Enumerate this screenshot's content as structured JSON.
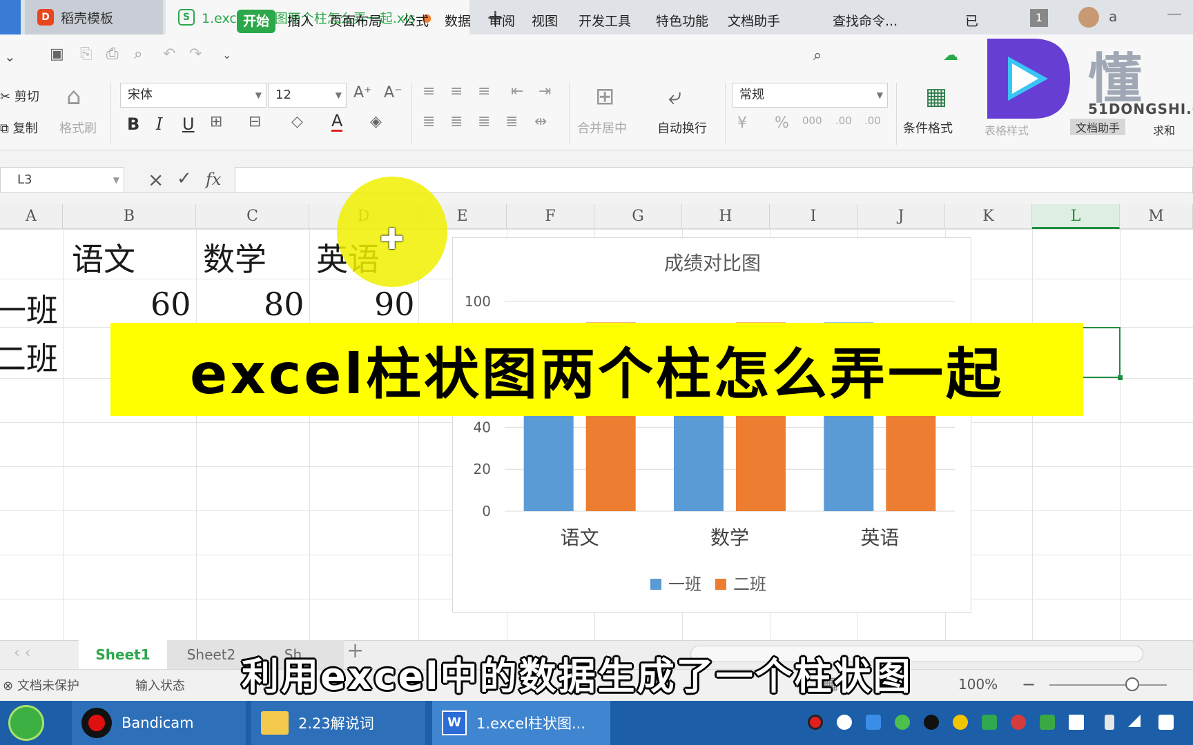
{
  "titlebar": {
    "tabs": [
      {
        "label": "稻壳模板",
        "active": false
      },
      {
        "label": "1.excel柱状图两个柱怎么弄一起.xls",
        "active": true
      }
    ],
    "new_tab_symbol": "+",
    "badge": "1",
    "user": "a",
    "minimize": "—"
  },
  "menu": {
    "items": [
      "开始",
      "插入",
      "页面布局",
      "公式",
      "数据",
      "审阅",
      "视图",
      "开发工具",
      "特色功能",
      "文档助手"
    ],
    "active": "开始",
    "search_placeholder": "查找命令...",
    "cloud_label": "已"
  },
  "ribbon": {
    "cut": "剪切",
    "copy": "复制",
    "format_painter": "格式刷",
    "font_name": "宋体",
    "font_size": "12",
    "merge_center": "合并居中",
    "wrap_text": "自动换行",
    "number_format": "常规",
    "conditional_format": "条件格式",
    "table_style": "表格样式",
    "doc_assistant": "文档助手",
    "sum": "求和"
  },
  "formula_bar": {
    "cell_ref": "L3",
    "fx": "fx",
    "content": ""
  },
  "columns": [
    "A",
    "B",
    "C",
    "D",
    "E",
    "F",
    "G",
    "H",
    "I",
    "J",
    "K",
    "L",
    "M"
  ],
  "cells": {
    "b1": "语文",
    "c1": "数学",
    "d1": "英语",
    "a2": "一班",
    "b2": "60",
    "c2": "80",
    "d2": "90",
    "a3": "二班"
  },
  "chart_data": {
    "type": "bar",
    "title": "成绩对比图",
    "categories": [
      "语文",
      "数学",
      "英语"
    ],
    "series": [
      {
        "name": "一班",
        "values": [
          60,
          80,
          90
        ],
        "color": "#5b9bd5"
      },
      {
        "name": "二班",
        "values": [
          90,
          90,
          60
        ],
        "color": "#ed7d31"
      }
    ],
    "ylim": [
      0,
      100
    ],
    "yticks": [
      "0",
      "20",
      "40",
      "100"
    ],
    "legend": "bottom",
    "grid": true
  },
  "banner_text": "excel柱状图两个柱怎么弄一起",
  "caption_text": "利用excel中的数据生成了一个柱状图",
  "sheets": {
    "tabs": [
      "Sheet1",
      "Sheet2",
      "Sh..."
    ],
    "active": "Sheet1",
    "add": "+"
  },
  "status": {
    "protect": "文档未保护",
    "input_state": "输入状态",
    "zoom": "100%"
  },
  "taskbar": {
    "apps": [
      "Bandicam",
      "2.23解说词",
      "1.excel柱状图..."
    ]
  },
  "watermark": {
    "brand": "懂",
    "url": "51DONGSHI.C"
  }
}
